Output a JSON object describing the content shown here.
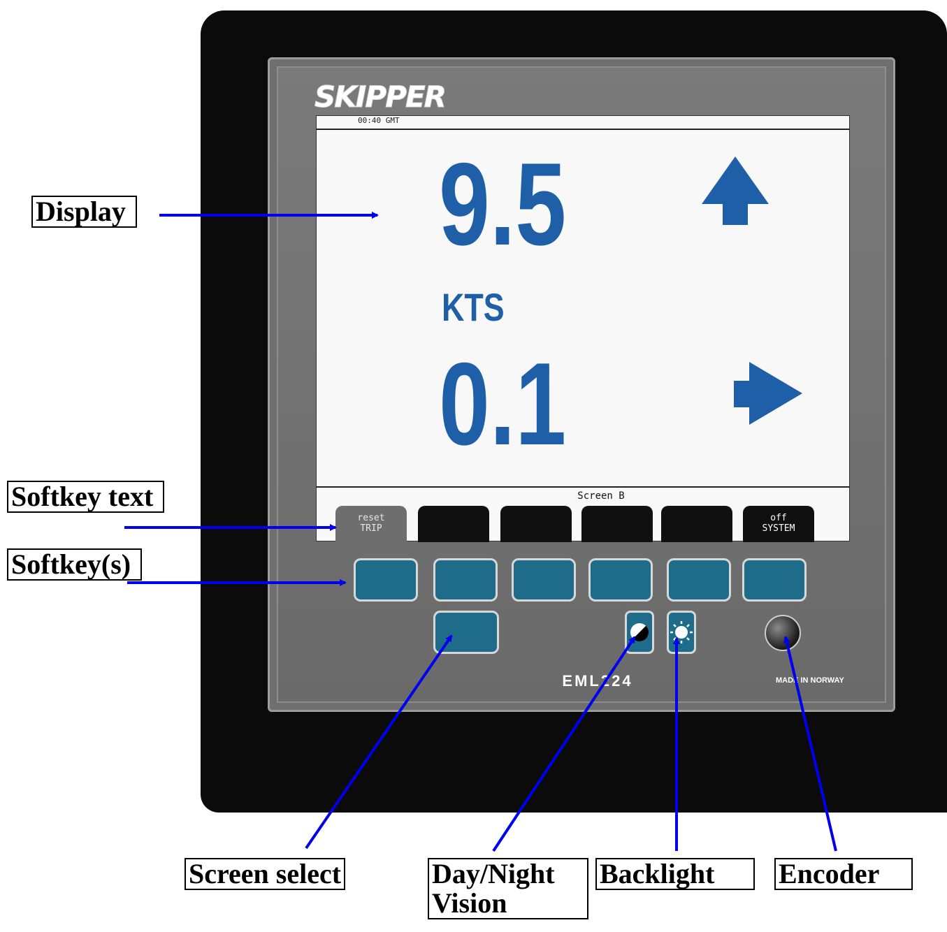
{
  "device": {
    "brand": "SKIPPER",
    "model": "EML224",
    "made_in": "MADE IN NORWAY"
  },
  "display": {
    "time": "00:40 GMT",
    "speed_longitudinal": "9.5",
    "unit": "KTS",
    "speed_transverse": "0.1",
    "screen_label": "Screen  B"
  },
  "softkeys": [
    {
      "top": "reset",
      "bottom": "TRIP"
    },
    {
      "top": "",
      "bottom": ""
    },
    {
      "top": "",
      "bottom": ""
    },
    {
      "top": "",
      "bottom": ""
    },
    {
      "top": "",
      "bottom": ""
    },
    {
      "top": "off",
      "bottom": "SYSTEM"
    }
  ],
  "callouts": {
    "display": "Display",
    "softkey_text": "Softkey text",
    "softkeys": "Softkey(s)",
    "screen_select": "Screen select",
    "day_night_1": "Day/Night",
    "day_night_2": "Vision",
    "backlight": "Backlight",
    "encoder": "Encoder"
  },
  "colors": {
    "arrow": "#0000ee",
    "digits": "#1e5fa7",
    "key": "#1f6b8a"
  },
  "icons": [
    "up-arrow-icon",
    "right-arrow-icon",
    "day-night-icon",
    "backlight-sun-icon"
  ]
}
